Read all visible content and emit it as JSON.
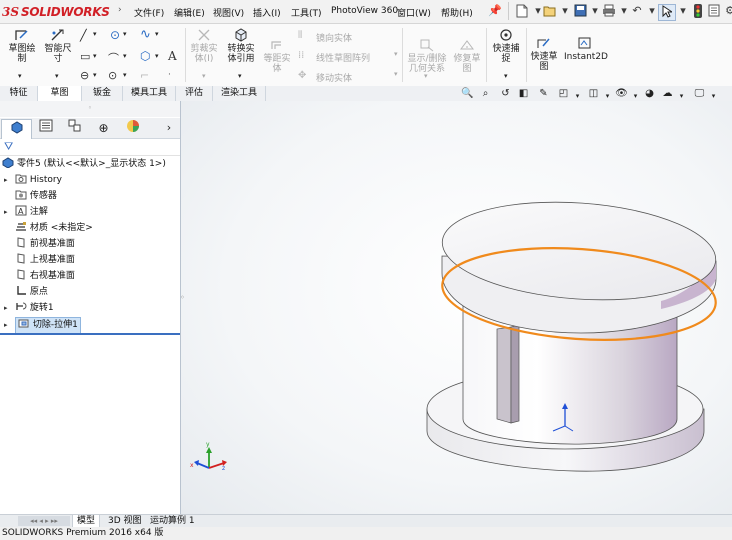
{
  "app": {
    "logo_ds": "3S",
    "logo_text": "SOLIDWORKS"
  },
  "menu": [
    {
      "label": "文件(F)"
    },
    {
      "label": "编辑(E)"
    },
    {
      "label": "视图(V)"
    },
    {
      "label": "插入(I)"
    },
    {
      "label": "工具(T)"
    },
    {
      "label": "PhotoView 360"
    },
    {
      "label": "窗口(W)"
    },
    {
      "label": "帮助(H)"
    }
  ],
  "ribbon": {
    "sketch": "草图绘\n制",
    "smart_dim": "智能尺\n寸",
    "trim": "剪裁实\n体(I)",
    "convert": "转换实\n体引用",
    "offset": "等距实\n体",
    "mirror": "镜向实体",
    "linear_pattern": "线性草图阵列",
    "move": "移动实体",
    "display_delete": "显示/删除\n几何关系",
    "repair": "修复草\n图",
    "quick_snap": "快速捕\n捉",
    "rapid_sketch": "快速草\n图",
    "instant2d": "Instant2D"
  },
  "tabs": [
    {
      "label": "特征"
    },
    {
      "label": "草图"
    },
    {
      "label": "钣金"
    },
    {
      "label": "模具工具"
    },
    {
      "label": "评估"
    },
    {
      "label": "渲染工具"
    }
  ],
  "tree": {
    "root": "零件5  (默认<<默认>_显示状态 1>)",
    "items": [
      {
        "label": "History",
        "expandable": true
      },
      {
        "label": "传感器",
        "expandable": false
      },
      {
        "label": "注解",
        "expandable": true
      },
      {
        "label": "材质 <未指定>",
        "expandable": false
      },
      {
        "label": "前视基准面",
        "expandable": false
      },
      {
        "label": "上视基准面",
        "expandable": false
      },
      {
        "label": "右视基准面",
        "expandable": false
      },
      {
        "label": "原点",
        "expandable": false
      },
      {
        "label": "旋转1",
        "expandable": true
      },
      {
        "label": "切除-拉伸1",
        "expandable": true,
        "selected": true
      }
    ]
  },
  "bottom_tabs": [
    {
      "label": "模型"
    },
    {
      "label": "3D 视图"
    },
    {
      "label": "运动算例 1"
    }
  ],
  "status": "SOLIDWORKS Premium 2016 x64 版",
  "colors": {
    "brand": "#d11f26",
    "selection_edge": "#f08a1c",
    "triad_x": "#d22020",
    "triad_y": "#2aa02a",
    "triad_z": "#1f4fd6"
  }
}
